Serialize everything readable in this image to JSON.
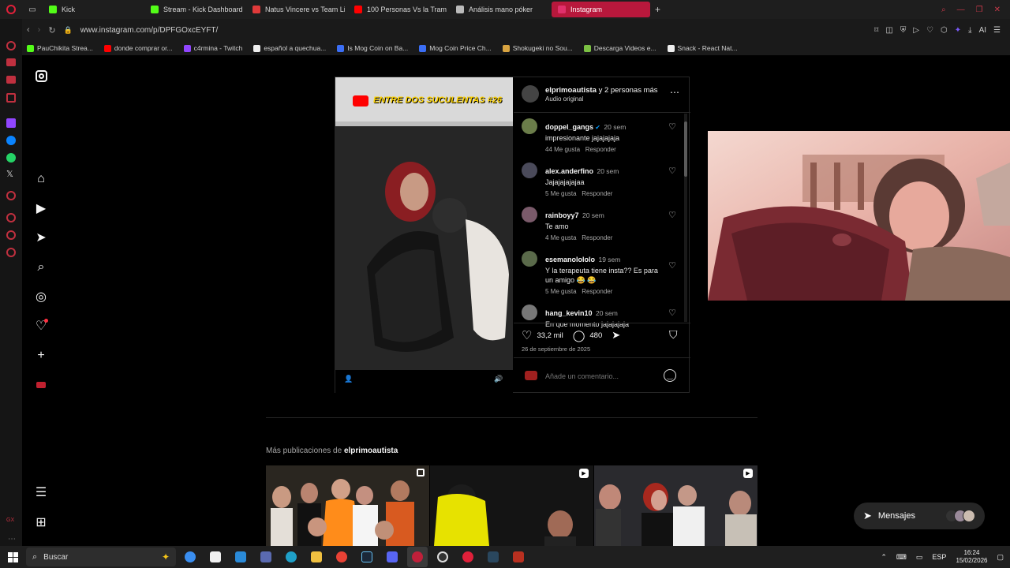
{
  "browser": {
    "tabs": [
      {
        "label": "Kick",
        "color": "#53fc18"
      },
      {
        "label": "Stream - Kick Dashboard",
        "color": "#53fc18"
      },
      {
        "label": "Natus Vincere vs Team Li",
        "color": "#e03a3a"
      },
      {
        "label": "100 Personas Vs la Tramp",
        "color": "#ff0000"
      },
      {
        "label": "Análisis mano póker",
        "color": "#bbbbbb"
      },
      {
        "label": "Instagram",
        "color": "#e1306c"
      }
    ],
    "url": "www.instagram.com/p/DPFGOxcEYFT/",
    "bookmarks": [
      {
        "label": "PauChikita Strea...",
        "color": "#53fc18"
      },
      {
        "label": "donde comprar or...",
        "color": "#ff0000"
      },
      {
        "label": "c4rmina - Twitch",
        "color": "#9146ff"
      },
      {
        "label": "español a quechua...",
        "color": "#eeeeee"
      },
      {
        "label": "Is Mog Coin on Ba...",
        "color": "#3b6ef5"
      },
      {
        "label": "Mog Coin Price Ch...",
        "color": "#3b6ef5"
      },
      {
        "label": "Shokugeki no Sou...",
        "color": "#d9a441"
      },
      {
        "label": "Descarga Videos e...",
        "color": "#7bc043"
      },
      {
        "label": "Snack - React Nat...",
        "color": "#eeeeee"
      }
    ]
  },
  "post": {
    "video_overlay_text": "ENTRE DOS SUCULENTAS #26",
    "author_line_user": "elprimoautista",
    "author_line_rest": " y 2 personas más",
    "audio": "Audio original",
    "comments": [
      {
        "user": "doppel_gangs",
        "time": "20 sem",
        "text": "impresionante jajajajaja",
        "likes": "44 Me gusta",
        "reply": "Responder",
        "color": "#6b7d4a"
      },
      {
        "user": "alex.anderfino",
        "time": "20 sem",
        "text": "Jajajajajajaa",
        "likes": "5 Me gusta",
        "reply": "Responder",
        "color": "#4a4a5a"
      },
      {
        "user": "rainboyy7",
        "time": "20 sem",
        "text": "Te amo",
        "likes": "4 Me gusta",
        "reply": "Responder",
        "color": "#7a5a6a"
      },
      {
        "user": "esemanolololo",
        "time": "19 sem",
        "text": "Y la terapeuta tiene insta?? Es para un amigo 😂 😂",
        "likes": "5 Me gusta",
        "reply": "Responder",
        "color": "#5a6a4a"
      },
      {
        "user": "hang_kevin10",
        "time": "20 sem",
        "text": "En que momento jajajajaja",
        "likes": "",
        "reply": "",
        "color": "#777777"
      }
    ],
    "likes_count": "33,2 mil",
    "comments_count": "480",
    "date": "26 de septiembre de 2025",
    "comment_placeholder": "Añade un comentario..."
  },
  "more": {
    "prefix": "Más publicaciones de ",
    "user": "elprimoautista"
  },
  "messages_label": "Mensajes",
  "taskbar": {
    "search": "Buscar",
    "lang": "ESP",
    "time": "16:24",
    "date": "15/02/2026"
  }
}
